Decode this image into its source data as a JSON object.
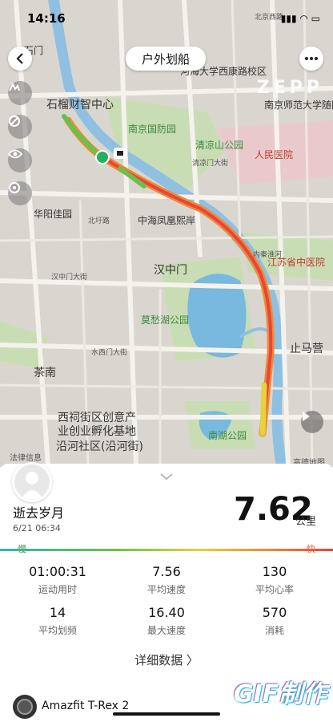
{
  "status_bar": {
    "time": "14:16",
    "icons": "▮▮▮ ◠ ▭"
  },
  "header": {
    "title": "户外划船",
    "back_icon": "chevron-left-icon",
    "more_icon": "more-icon"
  },
  "watermark": {
    "brand": "ZEPP"
  },
  "map": {
    "labels": [
      {
        "text": "北京西路",
        "kind": "road"
      },
      {
        "text": "石门",
        "kind": "place"
      },
      {
        "text": "石榴财智中心",
        "kind": "place"
      },
      {
        "text": "河海大学西康路校区",
        "kind": "place"
      },
      {
        "text": "南京师范大学随园",
        "kind": "place"
      },
      {
        "text": "南京国防园",
        "kind": "park"
      },
      {
        "text": "清凉山公园",
        "kind": "park"
      },
      {
        "text": "人民医院",
        "kind": "hospital"
      },
      {
        "text": "华阳佳园",
        "kind": "place"
      },
      {
        "text": "中海凤凰熙岸",
        "kind": "place"
      },
      {
        "text": "汉中门",
        "kind": "place"
      },
      {
        "text": "江苏省中医院",
        "kind": "hospital"
      },
      {
        "text": "莫愁湖公园",
        "kind": "park"
      },
      {
        "text": "止马营",
        "kind": "place"
      },
      {
        "text": "茶南",
        "kind": "place"
      },
      {
        "text": "汉中门大街",
        "kind": "road"
      },
      {
        "text": "水西门大街",
        "kind": "road"
      },
      {
        "text": "西祠街区创意产",
        "kind": "place"
      },
      {
        "text": "业创业孵化基地",
        "kind": "place"
      },
      {
        "text": "沿河社区(沿河街)",
        "kind": "place"
      },
      {
        "text": "南湖公园",
        "kind": "park"
      },
      {
        "text": "内秦淮河",
        "kind": "road"
      },
      {
        "text": "清凉门大街",
        "kind": "road"
      },
      {
        "text": "北圩路",
        "kind": "road"
      }
    ],
    "attribution_left": "法律信息",
    "attribution_right": "高德地图"
  },
  "summary": {
    "user_name": "逝去岁月",
    "date": "6/21 06:34",
    "distance": "7.62",
    "distance_unit": "公里",
    "slow_label": "慢",
    "fast_label": "快"
  },
  "stats": [
    {
      "value": "01:00:31",
      "label": "运动用时"
    },
    {
      "value": "7.56",
      "label": "平均速度"
    },
    {
      "value": "130",
      "label": "平均心率"
    },
    {
      "value": "14",
      "label": "平均划频"
    },
    {
      "value": "16.40",
      "label": "最大速度"
    },
    {
      "value": "570",
      "label": "消耗"
    }
  ],
  "detail_link": "详细数据 〉",
  "device_name": "Amazfit T-Rex 2",
  "gif_watermark": "GIF制作",
  "colors": {
    "speed_slow": "#2fb6a8",
    "speed_mid": "#e6d23a",
    "speed_fast": "#e8453a"
  }
}
